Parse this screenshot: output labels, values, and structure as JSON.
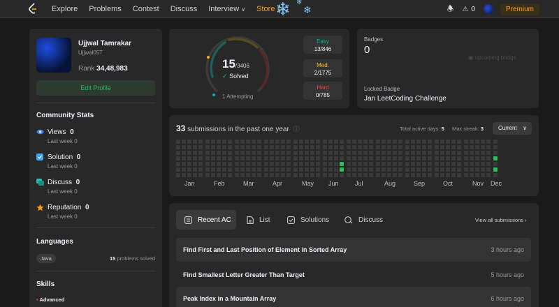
{
  "nav": {
    "items": [
      "Explore",
      "Problems",
      "Contest",
      "Discuss",
      "Interview",
      "Store"
    ],
    "fire_count": "0",
    "premium": "Premium"
  },
  "profile": {
    "name": "Ujjwal Tamrakar",
    "username": "Ujjwal05T",
    "rank_label": "Rank",
    "rank": "34,48,983",
    "edit": "Edit Profile"
  },
  "community": {
    "title": "Community Stats",
    "items": [
      {
        "label": "Views",
        "value": "0",
        "sub": "Last week 0"
      },
      {
        "label": "Solution",
        "value": "0",
        "sub": "Last week 0"
      },
      {
        "label": "Discuss",
        "value": "0",
        "sub": "Last week 0"
      },
      {
        "label": "Reputation",
        "value": "0",
        "sub": "Last week 0"
      }
    ]
  },
  "languages": {
    "title": "Languages",
    "name": "Java",
    "count": "15",
    "suffix": " problems solved"
  },
  "skills": {
    "title": "Skills",
    "level": "Advanced"
  },
  "solved": {
    "count": "15",
    "total": "/3406",
    "label": "Solved",
    "attempting": "1 Attempting",
    "easy": {
      "label": "Easy",
      "value": "13/846"
    },
    "medium": {
      "label": "Med.",
      "value": "2/1775"
    },
    "hard": {
      "label": "Hard",
      "value": "0/785"
    }
  },
  "badges": {
    "title": "Badges",
    "count": "0",
    "img_alt": "upcoming badge",
    "locked_label": "Locked Badge",
    "locked_name": "Jan LeetCoding Challenge"
  },
  "submissions": {
    "count": "33",
    "text": " submissions in the past one year",
    "active_label": "Total active days:",
    "active": "5",
    "streak_label": "Max streak:",
    "streak": "3",
    "select": "Current",
    "months": [
      "Jan",
      "Feb",
      "Mar",
      "Apr",
      "May",
      "Jun",
      "Jul",
      "Aug",
      "Sep",
      "Oct",
      "Nov",
      "Dec"
    ]
  },
  "tabs": [
    "Recent AC",
    "List",
    "Solutions",
    "Discuss"
  ],
  "view_all": "View all submissions",
  "recent": [
    {
      "title": "Find First and Last Position of Element in Sorted Array",
      "time": "3 hours ago"
    },
    {
      "title": "Find Smallest Letter Greater Than Target",
      "time": "5 hours ago"
    },
    {
      "title": "Peak Index in a Mountain Array",
      "time": "6 hours ago"
    }
  ],
  "colors": {
    "accent": "#ffa116",
    "easy": "#00b8a3",
    "medium": "#ffc01e",
    "hard": "#ef4743",
    "green": "#2cbb5d"
  }
}
